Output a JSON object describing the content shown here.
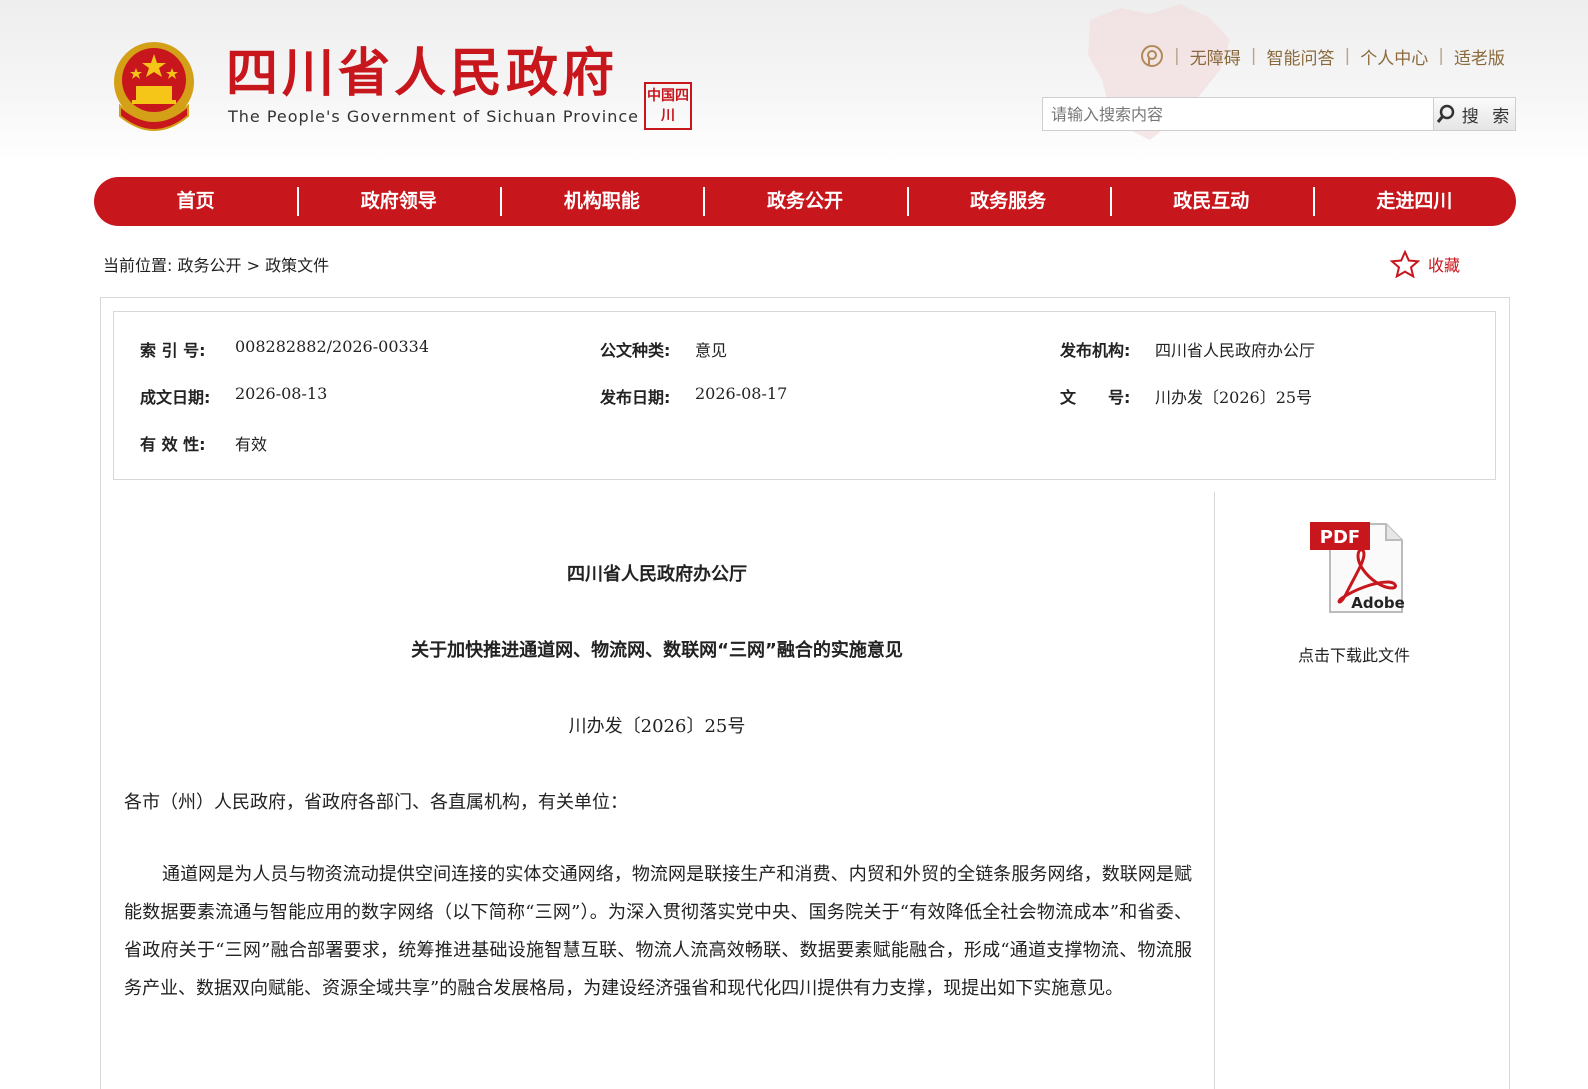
{
  "header": {
    "site_title": "四川省人民政府",
    "site_subtitle": "The People's Government of Sichuan Province",
    "seal_text": "中国四川",
    "top_links": [
      "无障碍",
      "智能问答",
      "个人中心",
      "适老版"
    ],
    "search_placeholder": "请输入搜索内容",
    "search_button": "搜 索"
  },
  "nav": {
    "items": [
      "首页",
      "政府领导",
      "机构职能",
      "政务公开",
      "政务服务",
      "政民互动",
      "走进四川"
    ]
  },
  "breadcrumb": {
    "prefix": "当前位置:",
    "items": [
      "政务公开",
      "政策文件"
    ],
    "separator": ">"
  },
  "favorite_label": "收藏",
  "meta": {
    "index_label": "索 引 号:",
    "index_value": "008282882/2026-00334",
    "type_label": "公文种类:",
    "type_value": "意见",
    "publisher_label": "发布机构:",
    "publisher_value": "四川省人民政府办公厅",
    "created_label": "成文日期:",
    "created_value": "2026-08-13",
    "published_label": "发布日期:",
    "published_value": "2026-08-17",
    "doc_no_label": "文　　号:",
    "doc_no_value": "川办发〔2026〕25号",
    "validity_label": "有 效 性:",
    "validity_value": "有效"
  },
  "document": {
    "org": "四川省人民政府办公厅",
    "title": "关于加快推进通道网、物流网、数联网“三网”融合的实施意见",
    "number": "川办发〔2026〕25号",
    "salutation": "各市（州）人民政府，省政府各部门、各直属机构，有关单位：",
    "paragraph": "通道网是为人员与物资流动提供空间连接的实体交通网络，物流网是联接生产和消费、内贸和外贸的全链条服务网络，数联网是赋能数据要素流通与智能应用的数字网络（以下简称“三网”）。为深入贯彻落实党中央、国务院关于“有效降低全社会物流成本”和省委、省政府关于“三网”融合部署要求，统筹推进基础设施智慧互联、物流人流高效畅联、数据要素赋能融合，形成“通道支撑物流、物流服务产业、数据双向赋能、资源全域共享”的融合发展格局，为建设经济强省和现代化四川提供有力支撑，现提出如下实施意见。"
  },
  "sidebar": {
    "pdf_badge": "PDF",
    "pdf_brand": "Adobe",
    "download_label": "点击下载此文件"
  },
  "colors": {
    "brand_red": "#c8161d",
    "link_brown": "#8a6a3c"
  }
}
